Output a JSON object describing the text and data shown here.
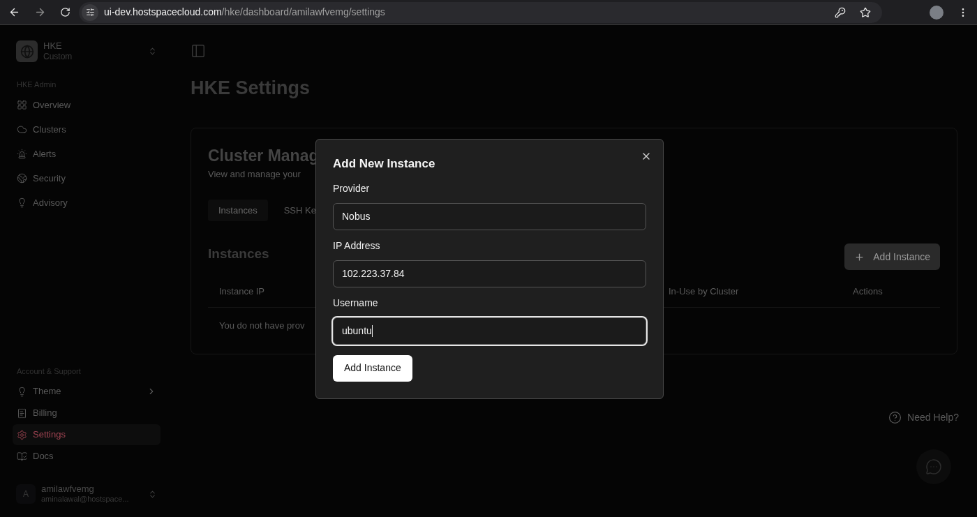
{
  "browser": {
    "url_host": "ui-dev.hostspacecloud.com",
    "url_path": "/hke/dashboard/amilawfvemg/settings"
  },
  "sidebar": {
    "org": {
      "name": "HKE",
      "plan": "Custom"
    },
    "sections": [
      {
        "title": "HKE Admin",
        "items": [
          {
            "label": "Overview",
            "selected": false,
            "submenu": false
          },
          {
            "label": "Clusters",
            "selected": false,
            "submenu": false
          },
          {
            "label": "Alerts",
            "selected": false,
            "submenu": false
          },
          {
            "label": "Security",
            "selected": false,
            "submenu": false
          },
          {
            "label": "Advisory",
            "selected": false,
            "submenu": false
          }
        ]
      },
      {
        "title": "Account & Support",
        "items": [
          {
            "label": "Theme",
            "selected": false,
            "submenu": true
          },
          {
            "label": "Billing",
            "selected": false,
            "submenu": false
          },
          {
            "label": "Settings",
            "selected": true,
            "submenu": false
          },
          {
            "label": "Docs",
            "selected": false,
            "submenu": false
          }
        ]
      }
    ],
    "user": {
      "initial": "A",
      "name": "amilawfvemg",
      "email": "aminalawal@hostspace..."
    }
  },
  "page": {
    "title": "HKE Settings",
    "card": {
      "title": "Cluster Manag",
      "subtitle": "View and manage your",
      "tabs": [
        {
          "label": "Instances",
          "selected": true
        },
        {
          "label": "SSH Ke",
          "selected": false
        }
      ],
      "section_title": "Instances",
      "add_button": "Add Instance",
      "table": {
        "columns": [
          "Instance IP",
          "In-Use by Cluster",
          "Actions"
        ],
        "empty_message": "You do not have prov"
      }
    }
  },
  "dialog": {
    "title": "Add New Instance",
    "fields": [
      {
        "label": "Provider",
        "value": "Nobus",
        "focused": false
      },
      {
        "label": "IP Address",
        "value": "102.223.37.84",
        "focused": false
      },
      {
        "label": "Username",
        "value": "ubuntu",
        "focused": true
      }
    ],
    "submit": "Add Instance"
  },
  "help": {
    "label": "Need Help?"
  }
}
